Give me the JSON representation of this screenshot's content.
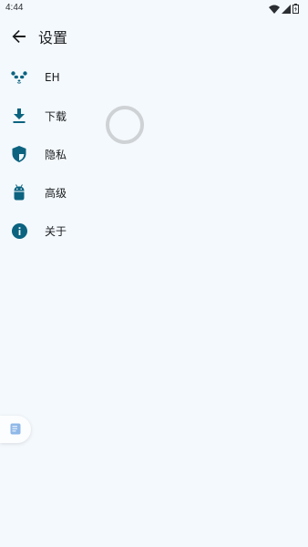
{
  "status_bar": {
    "time": "4:44",
    "icons": [
      "wifi-icon",
      "signal-icon",
      "battery-icon"
    ]
  },
  "app_bar": {
    "back_icon": "arrow-back-icon",
    "title": "设置"
  },
  "menu": {
    "items": [
      {
        "icon": "panda-icon",
        "label": "EH"
      },
      {
        "icon": "download-icon",
        "label": "下载"
      },
      {
        "icon": "shield-icon",
        "label": "隐私"
      },
      {
        "icon": "android-icon",
        "label": "高级"
      },
      {
        "icon": "info-icon",
        "label": "关于"
      }
    ]
  },
  "floating_tab": {
    "icon": "note-icon"
  },
  "colors": {
    "background": "#f4f9fd",
    "accent": "#0b6380",
    "text": "#1a1c1e",
    "spinner": "#cfd2d5"
  }
}
